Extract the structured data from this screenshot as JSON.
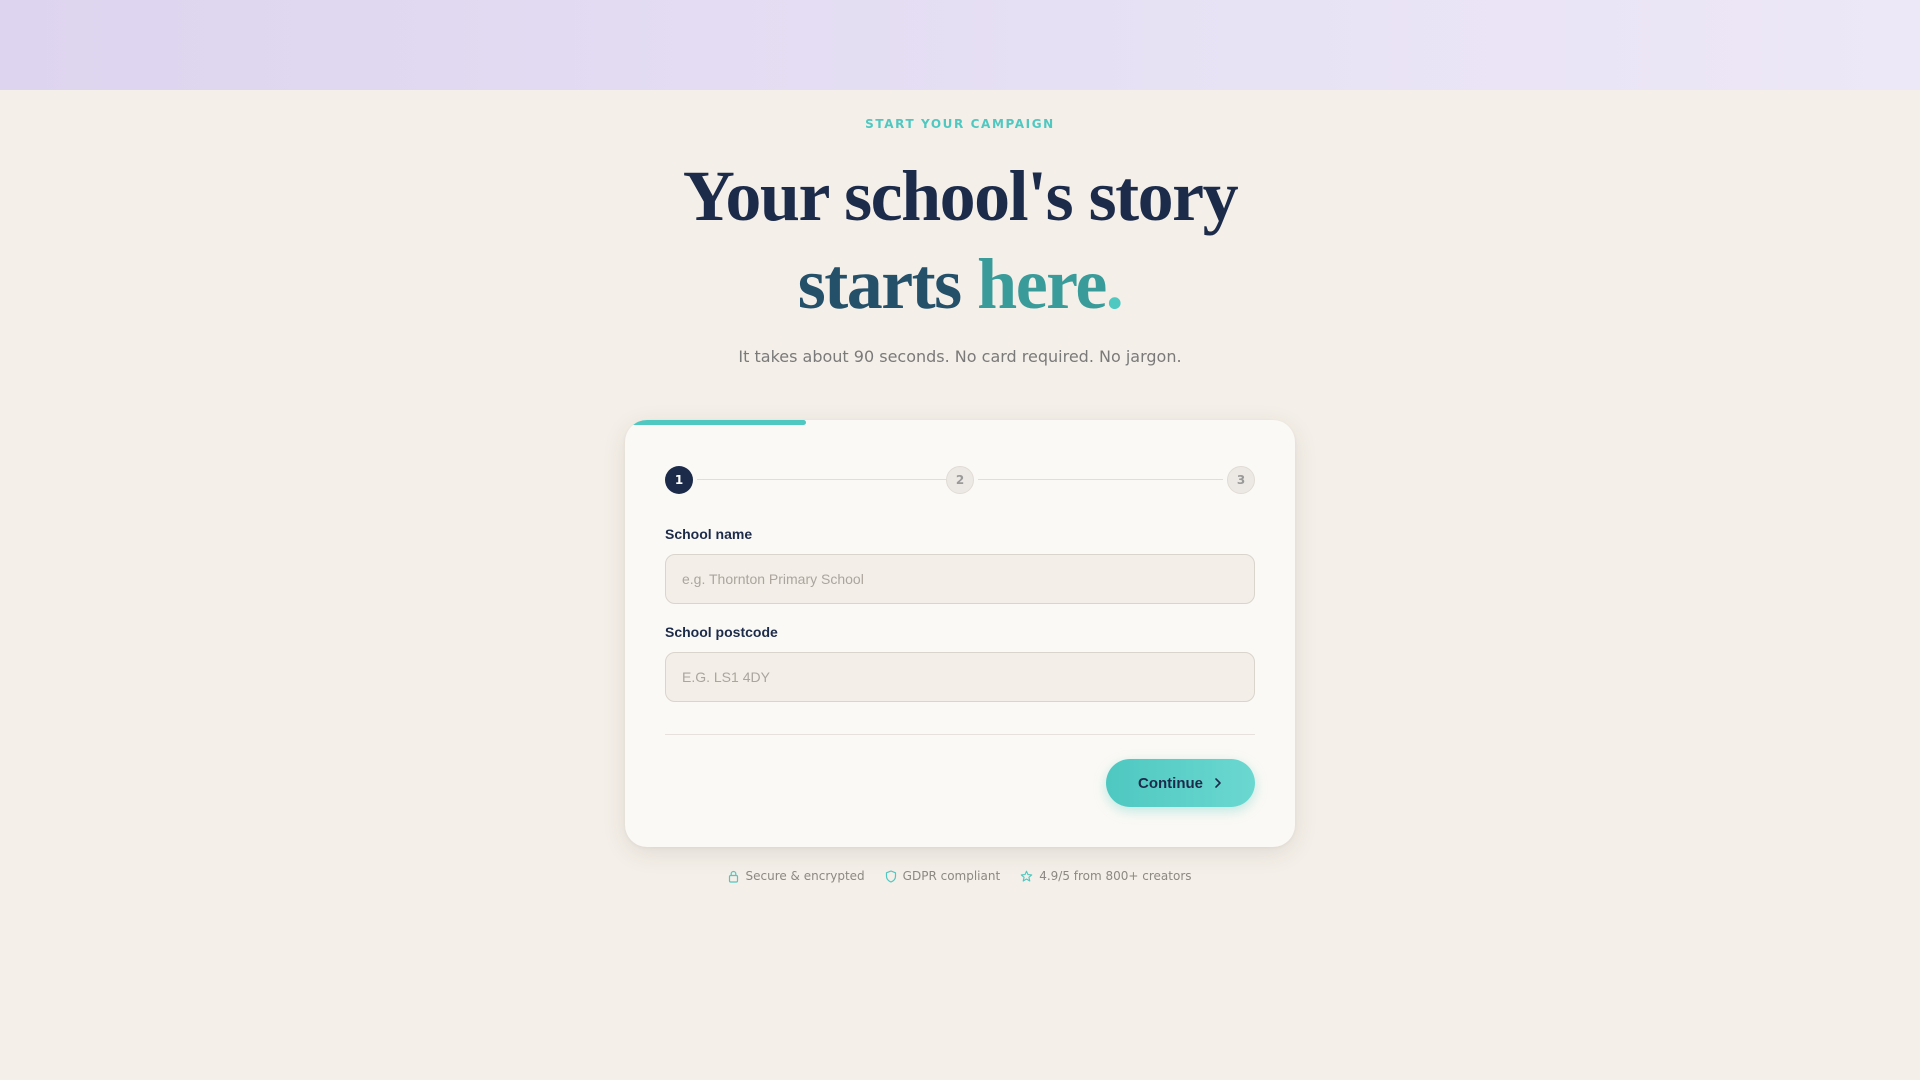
{
  "hero": {
    "eyebrow": "START YOUR CAMPAIGN",
    "headline_line1": "Your school's story",
    "headline_starts": "starts",
    "headline_here": "here",
    "headline_dot": ".",
    "subtitle": "It takes about 90 seconds. No card required. No jargon."
  },
  "form": {
    "progress_fraction": 0.27,
    "steps": [
      {
        "number": "1",
        "state": "active"
      },
      {
        "number": "2",
        "state": "idle"
      },
      {
        "number": "3",
        "state": "idle"
      }
    ],
    "school_name": {
      "label": "School name",
      "placeholder": "e.g. Thornton Primary School",
      "value": ""
    },
    "school_postcode": {
      "label": "School postcode",
      "placeholder": "E.G. LS1 4DY",
      "value": ""
    },
    "continue_label": "Continue"
  },
  "trust": {
    "secure": "Secure & encrypted",
    "gdpr": "GDPR compliant",
    "rating": "4.9/5 from 800+ creators"
  },
  "colors": {
    "accent": "#4ec8c1",
    "navy": "#1d2b4b",
    "teal_dark": "#3a9c9a",
    "background": "#f4efe8",
    "banner": "#e2dbf2"
  },
  "icons": {
    "lock": "lock-icon",
    "shield": "shield-icon",
    "star": "star-icon",
    "chevron": "chevron-right-icon"
  }
}
